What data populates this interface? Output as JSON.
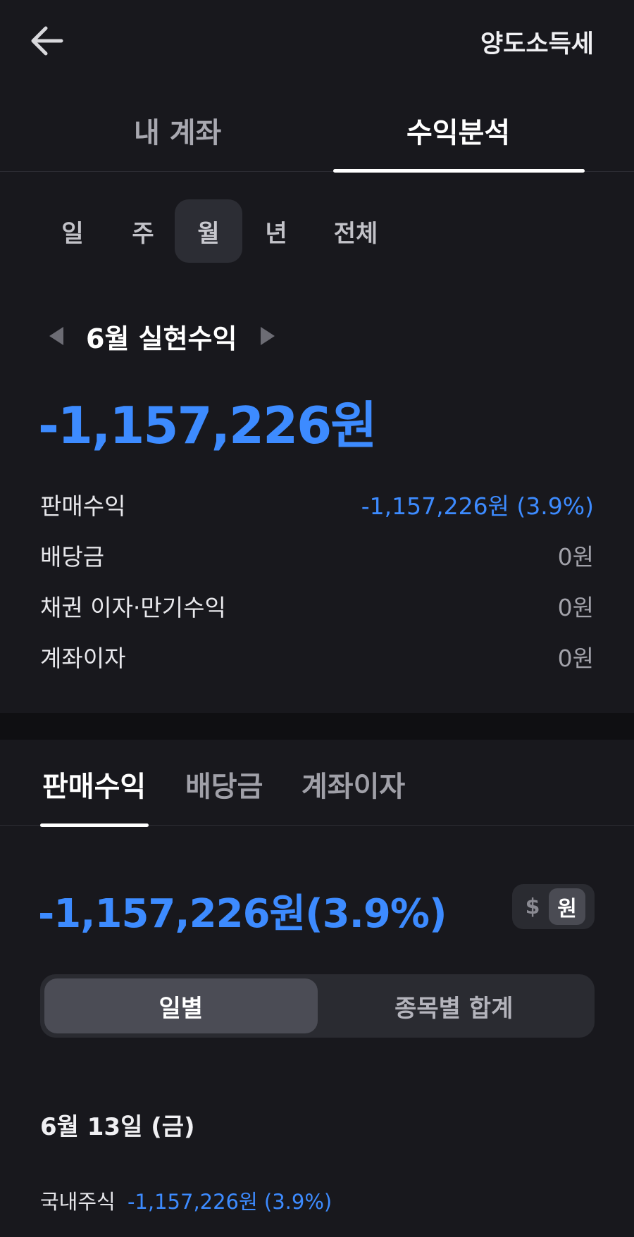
{
  "header": {
    "back_icon": "arrow-left-icon",
    "right_link": "양도소득세"
  },
  "main_tabs": [
    {
      "label": "내 계좌",
      "active": false
    },
    {
      "label": "수익분석",
      "active": true
    }
  ],
  "period": {
    "items": [
      "일",
      "주",
      "월",
      "년",
      "전체"
    ],
    "selected": "월"
  },
  "month_nav": {
    "prev_icon": "triangle-left-icon",
    "title": "6월 실현수익",
    "next_icon": "triangle-right-icon"
  },
  "total_value": "-1,157,226원",
  "summary": [
    {
      "label": "판매수익",
      "value": "-1,157,226원 (3.9%)",
      "color": "#3d8bff"
    },
    {
      "label": "배당금",
      "value": "0원"
    },
    {
      "label": "채권 이자·만기수익",
      "value": "0원"
    },
    {
      "label": "계좌이자",
      "value": "0원"
    }
  ],
  "sub_tabs": [
    {
      "label": "판매수익",
      "active": true
    },
    {
      "label": "배당금",
      "active": false
    },
    {
      "label": "계좌이자",
      "active": false
    }
  ],
  "sub_value": "-1,157,226원(3.9%)",
  "currency_toggle": {
    "usd": "$",
    "krw": "원",
    "selected": "원"
  },
  "segment": {
    "options": [
      "일별",
      "종목별 합계"
    ],
    "selected": "일별"
  },
  "date_header": "6월 13일 (금)",
  "entry": {
    "label": "국내주식",
    "value": "-1,157,226원 (3.9%)"
  },
  "colors": {
    "background": "#18181d",
    "accent_blue": "#3d8bff",
    "band": "#0f0f12"
  }
}
